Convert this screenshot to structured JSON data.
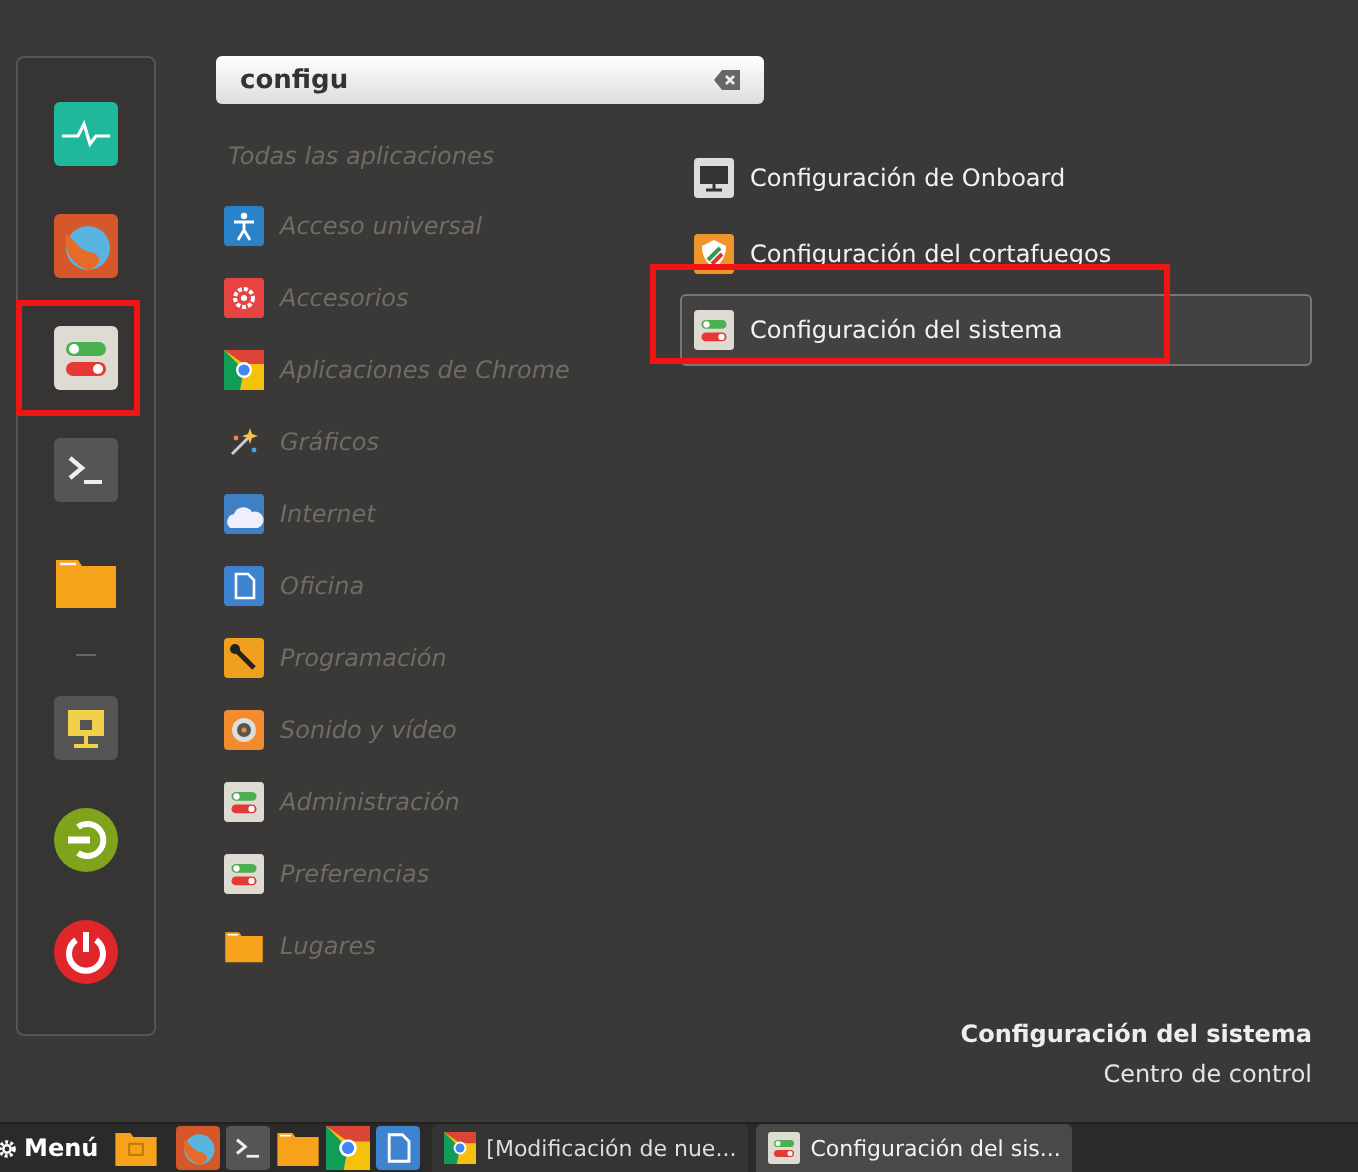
{
  "search": {
    "value": "configu"
  },
  "categories": [
    {
      "label": "Todas las aplicaciones"
    },
    {
      "label": "Acceso universal"
    },
    {
      "label": "Accesorios"
    },
    {
      "label": "Aplicaciones de Chrome"
    },
    {
      "label": "Gráficos"
    },
    {
      "label": "Internet"
    },
    {
      "label": "Oficina"
    },
    {
      "label": "Programación"
    },
    {
      "label": "Sonido y vídeo"
    },
    {
      "label": "Administración"
    },
    {
      "label": "Preferencias"
    },
    {
      "label": "Lugares"
    }
  ],
  "results": [
    {
      "label": "Configuración de Onboard",
      "selected": false
    },
    {
      "label": "Configuración del cortafuegos",
      "selected": false
    },
    {
      "label": "Configuración del sistema",
      "selected": true
    }
  ],
  "description": {
    "title": "Configuración del sistema",
    "subtitle": "Centro de control"
  },
  "taskbar": {
    "menu_label": "Menú",
    "windows": [
      {
        "title": "[Modificación de nue...",
        "selected": false
      },
      {
        "title": "Configuración del sis...",
        "selected": true
      }
    ]
  }
}
